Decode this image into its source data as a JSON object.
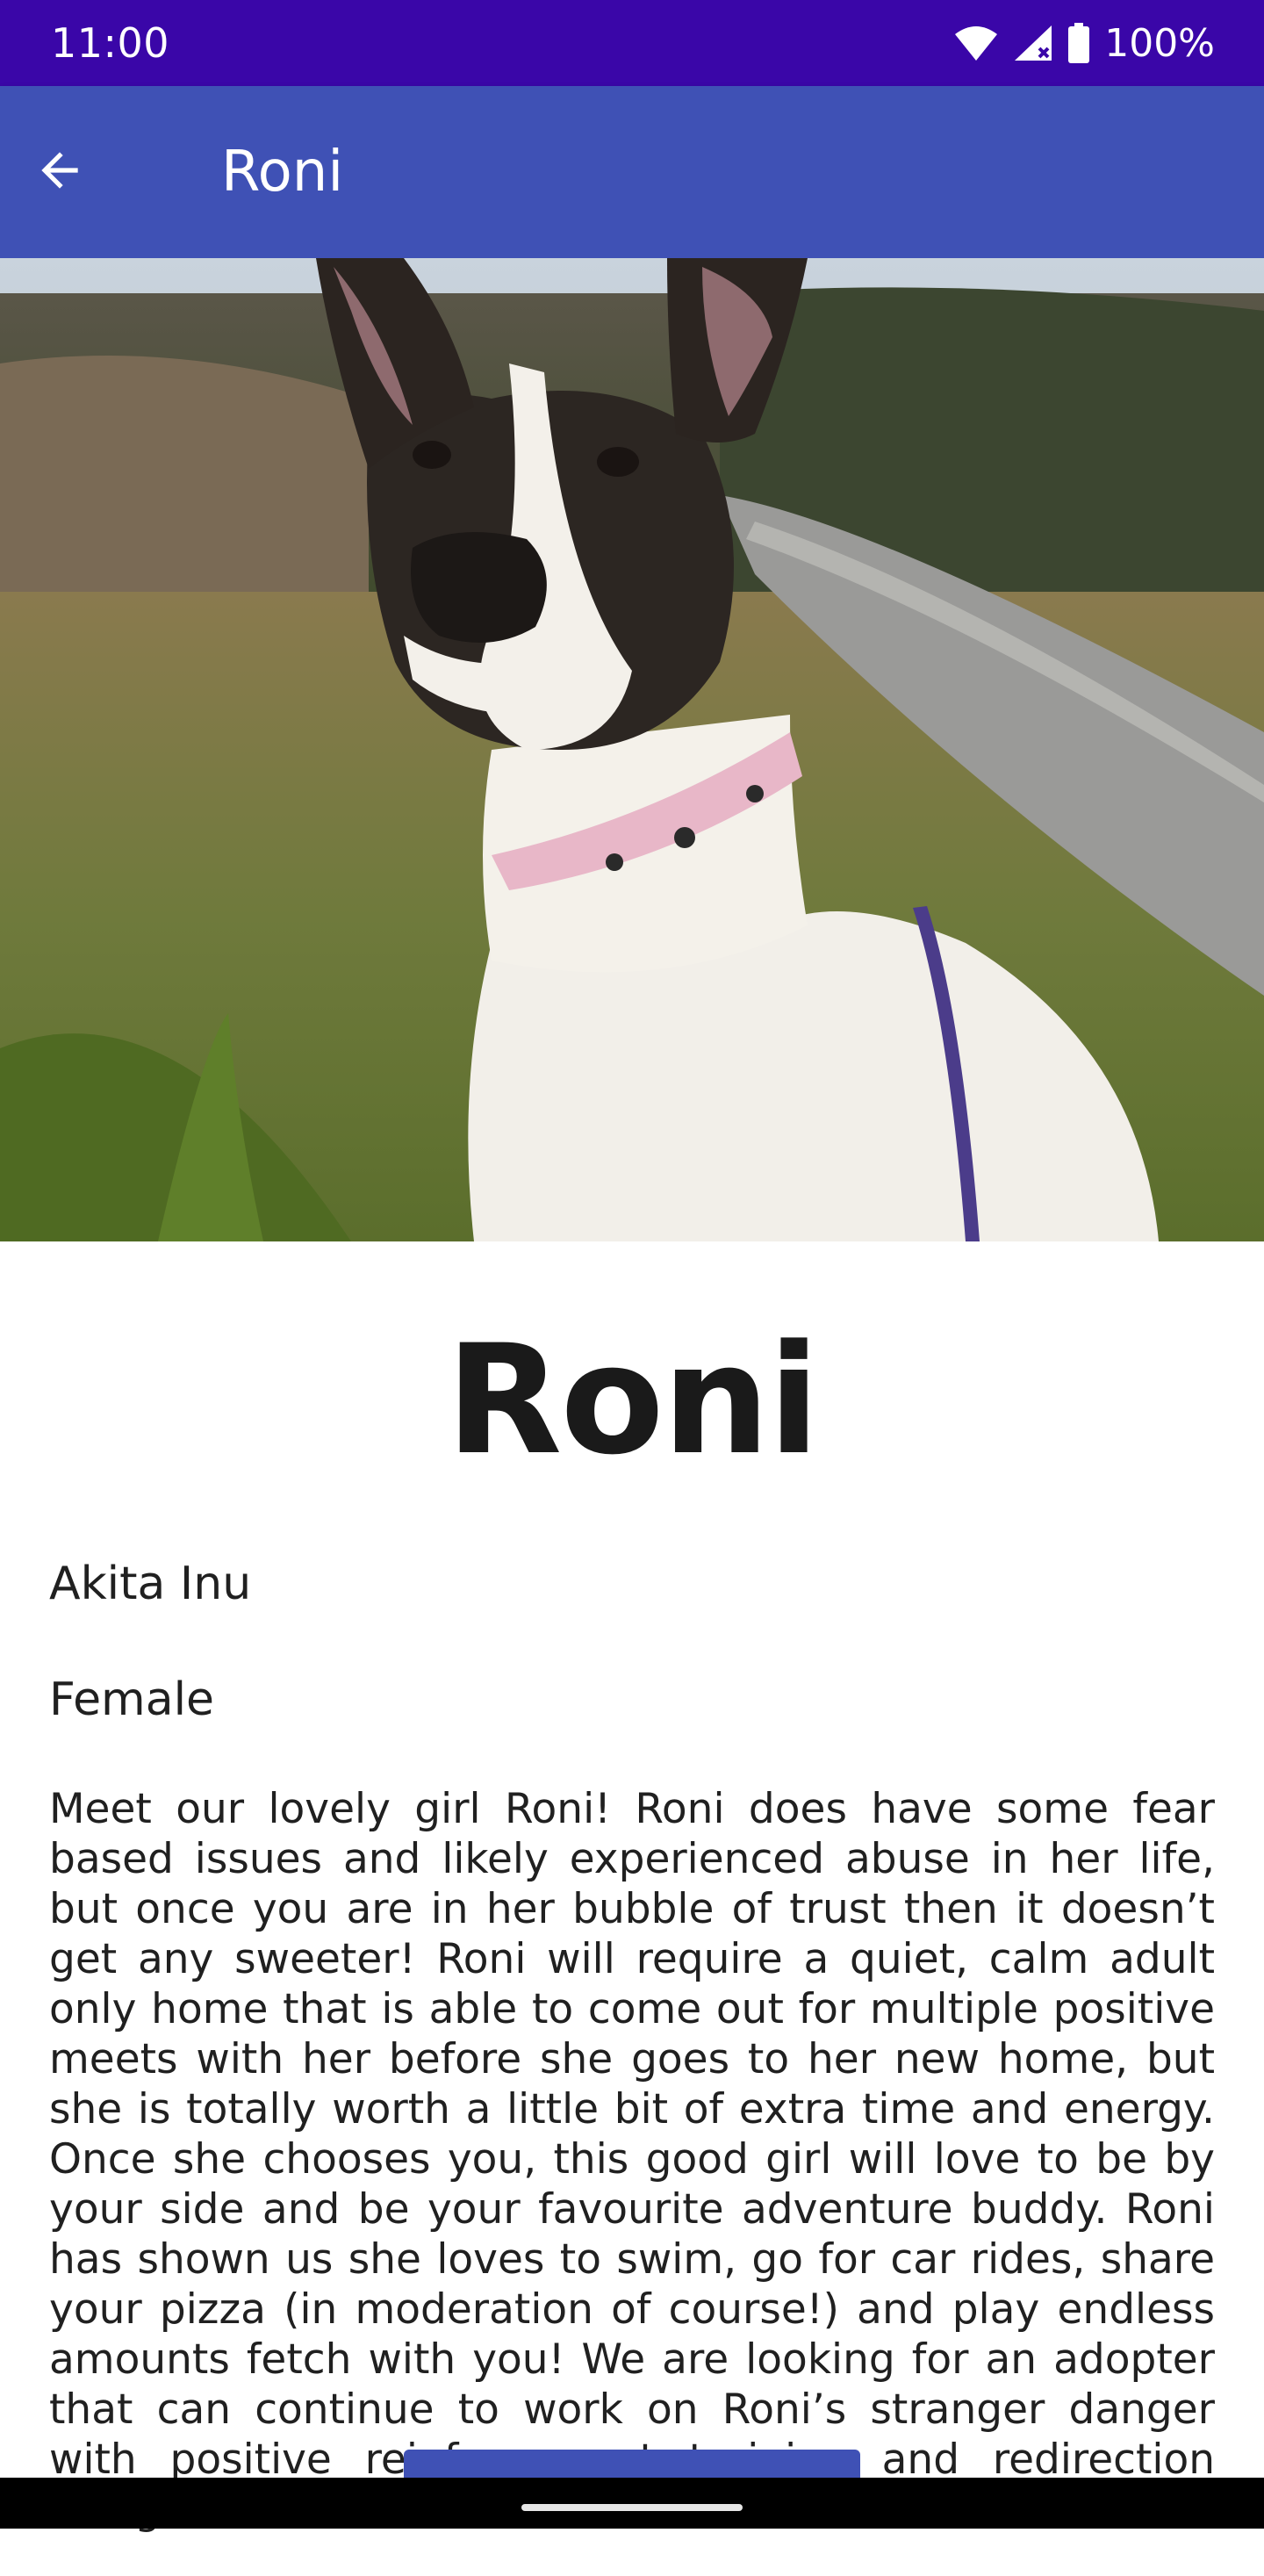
{
  "status_bar": {
    "time": "11:00",
    "battery": "100%",
    "icons": [
      "wifi-icon",
      "signal-icon",
      "battery-icon"
    ]
  },
  "app_bar": {
    "title": "Roni",
    "back_icon": "arrow-back-icon"
  },
  "hero": {
    "subject": "dog-photo"
  },
  "pet": {
    "name": "Roni",
    "breed": "Akita Inu",
    "sex": "Female",
    "description": "Meet our lovely girl Roni! Roni does have some fear based issues and likely experienced abuse in her life, but once you are in her bubble of trust then it doesn’t get any sweeter! Roni will require a quiet, calm adult only home that is able to come out for multiple positive meets with her before she goes to her new home, but she is totally worth a little bit of extra time and energy. Once she chooses you, this good girl will love to be by your side and be your favourite adventure buddy. Roni has shown us she loves to swim, go for car rides, share your pizza (in moderation of course!) and play endless amounts fetch with you! We are looking for an adopter that can continue to work on Roni’s stranger danger with positive reinforcement training and redirection using her favourite"
  },
  "colors": {
    "status_bar": "#3a06a8",
    "app_bar": "#3f51b5",
    "accent": "#3f51b5"
  }
}
